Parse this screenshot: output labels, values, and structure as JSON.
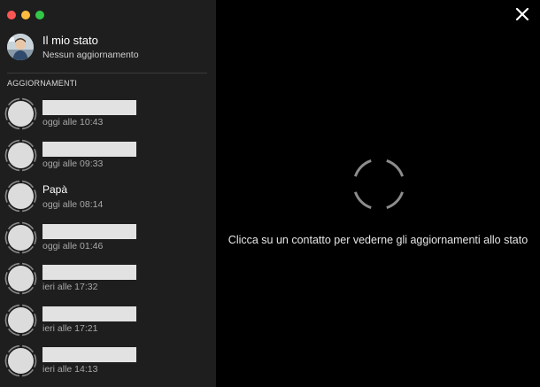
{
  "window": {
    "controls": [
      "close",
      "minimize",
      "maximize"
    ]
  },
  "my_status": {
    "title": "Il mio stato",
    "subtitle": "Nessun aggiornamento",
    "avatar": "avatar-photo"
  },
  "updates": {
    "section_title": "AGGIORNAMENTI",
    "items": [
      {
        "name": "",
        "name_hidden": true,
        "time": "oggi alle 10:43"
      },
      {
        "name": "",
        "name_hidden": true,
        "time": "oggi alle 09:33"
      },
      {
        "name": "Papà",
        "name_hidden": false,
        "time": "oggi alle 08:14"
      },
      {
        "name": "",
        "name_hidden": true,
        "time": "oggi alle 01:46"
      },
      {
        "name": "",
        "name_hidden": true,
        "time": "ieri alle 17:32"
      },
      {
        "name": "",
        "name_hidden": true,
        "time": "ieri alle 17:21"
      },
      {
        "name": "",
        "name_hidden": true,
        "time": "ieri alle 14:13"
      }
    ]
  },
  "main": {
    "close_icon": "close-icon",
    "spinner_icon": "status-ring-icon",
    "placeholder_text": "Clicca su un contatto per vederne gli aggiornamenti allo stato"
  },
  "colors": {
    "sidebar_bg": "#1e1e1e",
    "main_bg": "#000000",
    "traffic_close": "#fc5753",
    "traffic_min": "#fdbc40",
    "traffic_max": "#33c748",
    "redaction": "#e2e2e2"
  }
}
